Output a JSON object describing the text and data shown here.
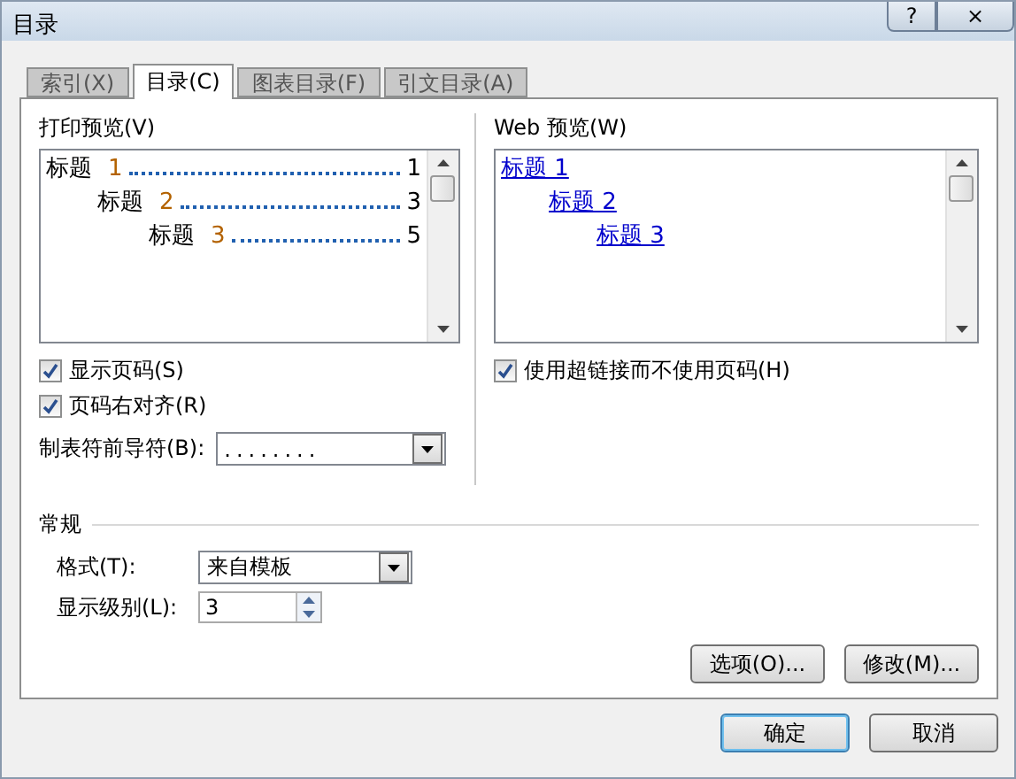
{
  "window": {
    "title": "目录",
    "buttons": [
      {
        "kind": "help",
        "label": "?"
      },
      {
        "kind": "close",
        "label": "×"
      }
    ]
  },
  "tabs": [
    {
      "label": "索引(X)",
      "selected": false
    },
    {
      "label": "目录(C)",
      "selected": true
    },
    {
      "label": "图表目录(F)",
      "selected": false
    },
    {
      "label": "引文目录(A)",
      "selected": false
    }
  ],
  "print_preview": {
    "label": "打印预览(V)",
    "entries": [
      {
        "text": "标题",
        "number": "1",
        "page": "1",
        "children": [
          {
            "text": "标题",
            "number": "2",
            "page": "3",
            "children": [
              {
                "text": "标题",
                "number": "3",
                "page": "5"
              }
            ]
          }
        ]
      }
    ]
  },
  "print_options": [
    {
      "label": "显示页码(S)",
      "checked": true
    },
    {
      "label": "页码右对齐(R)",
      "checked": true
    }
  ],
  "tab_leader": {
    "label": "制表符前导符(B):",
    "value": "........"
  },
  "web_preview": {
    "label": "Web 预览(W)",
    "entries": [
      {
        "text": "标题 1",
        "children": [
          {
            "text": "标题 2",
            "children": [
              {
                "text": "标题 3"
              }
            ]
          }
        ]
      }
    ]
  },
  "web_options": [
    {
      "label": "使用超链接而不使用页码(H)",
      "checked": true
    }
  ],
  "general": {
    "title": "常规",
    "format": {
      "label": "格式(T):",
      "value": "来自模板"
    },
    "levels": {
      "label": "显示级别(L):",
      "value": "3"
    }
  },
  "panel_buttons": [
    "选项(O)...",
    "修改(M)..."
  ],
  "dialog_buttons": [
    {
      "label": "确定",
      "selected": true
    },
    {
      "label": "取消",
      "selected": false
    }
  ]
}
